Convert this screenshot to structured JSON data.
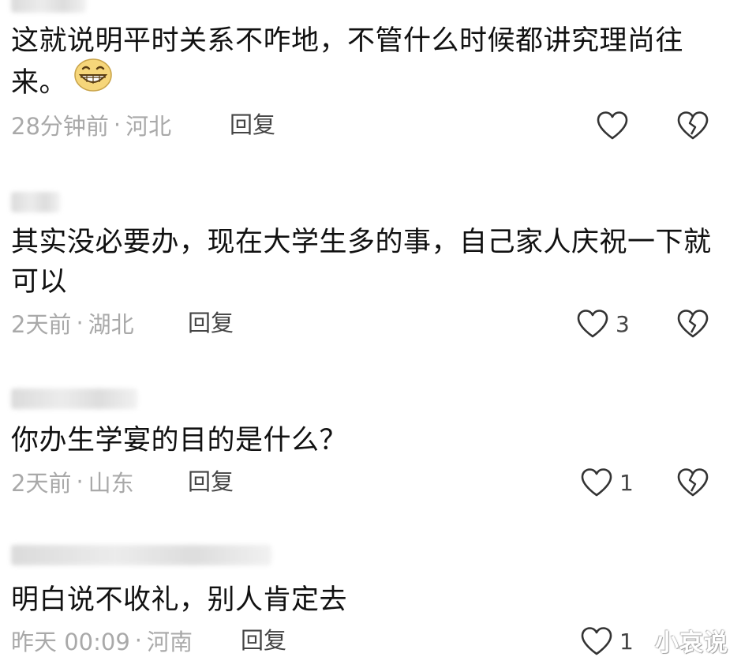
{
  "comments": [
    {
      "text": "这就说明平时关系不咋地，不管什么时候都讲究理尚往来。",
      "emoji": "grin-icon",
      "time": "28分钟前",
      "location": "河北",
      "reply": "回复",
      "likes": ""
    },
    {
      "text": "其实没必要办，现在大学生多的事，自己家人庆祝一下就可以",
      "time": "2天前",
      "location": "湖北",
      "reply": "回复",
      "likes": "3"
    },
    {
      "text": "你办生学宴的目的是什么？",
      "time": "2天前",
      "location": "山东",
      "reply": "回复",
      "likes": "1"
    },
    {
      "text": "明白说不收礼，别人肯定去",
      "time": "昨天 00:09",
      "location": "河南",
      "reply": "回复",
      "likes": "1"
    }
  ],
  "separator": "·",
  "watermark": "小哀说",
  "colors": {
    "text": "#111111",
    "meta": "#a9a9a9",
    "reply": "#444444",
    "icon": "#333333"
  }
}
